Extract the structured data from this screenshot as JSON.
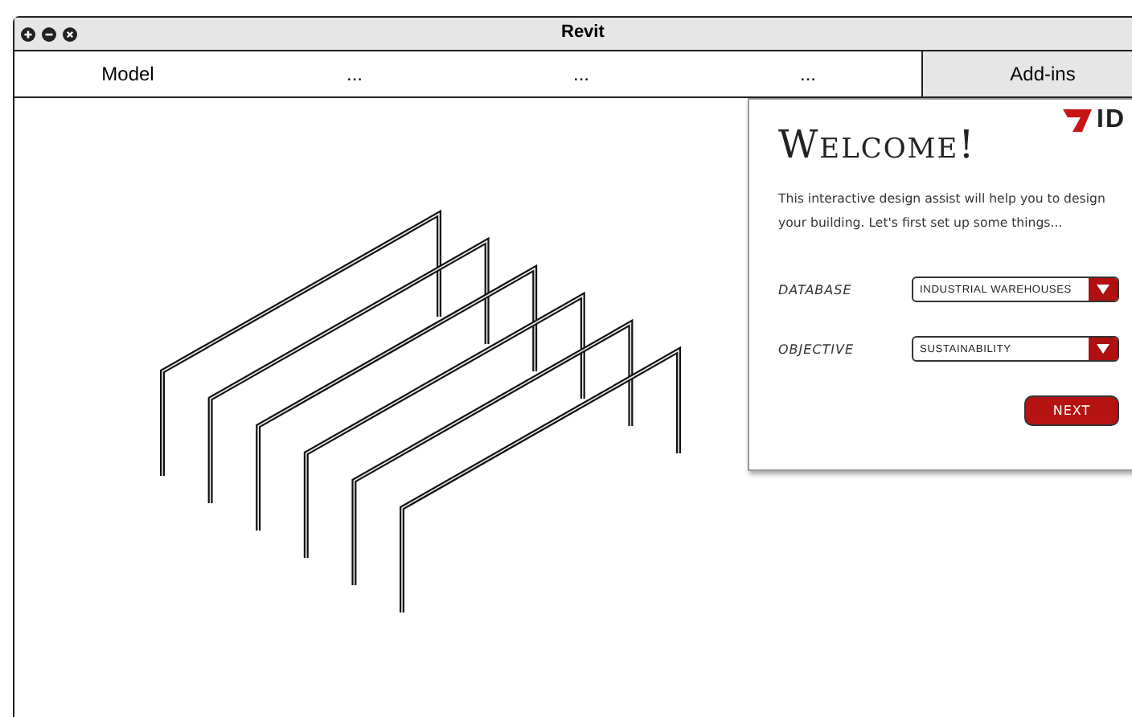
{
  "window": {
    "title": "Revit"
  },
  "tabs": [
    {
      "label": "Model",
      "selected": false
    },
    {
      "label": "...",
      "selected": false
    },
    {
      "label": "...",
      "selected": false
    },
    {
      "label": "...",
      "selected": false
    },
    {
      "label": "Add-ins",
      "selected": true
    }
  ],
  "panel": {
    "logo": "ID",
    "title": "Welcome!",
    "intro": "This interactive design assist will help you to design your building. Let's first set up some things...",
    "fields": [
      {
        "label": "DATABASE",
        "value": "INDUSTRIAL WAREHOUSES"
      },
      {
        "label": "OBJECTIVE",
        "value": "SUSTAINABILITY"
      }
    ],
    "next_button": "NEXT"
  }
}
